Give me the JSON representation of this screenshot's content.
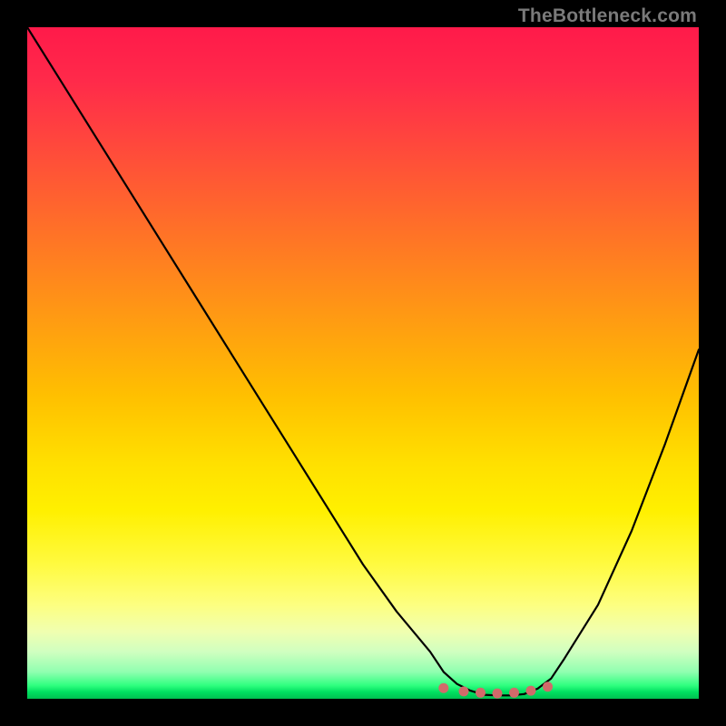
{
  "watermark": "TheBottleneck.com",
  "chart_data": {
    "type": "line",
    "title": "",
    "xlabel": "",
    "ylabel": "",
    "xlim": [
      0,
      100
    ],
    "ylim": [
      0,
      100
    ],
    "grid": false,
    "series": [
      {
        "name": "bottleneck-curve",
        "x": [
          0,
          5,
          10,
          15,
          20,
          25,
          30,
          35,
          40,
          45,
          50,
          55,
          60,
          62,
          64,
          66,
          68,
          70,
          72,
          74,
          76,
          78,
          80,
          85,
          90,
          95,
          100
        ],
        "y": [
          100,
          92,
          84,
          76,
          68,
          60,
          52,
          44,
          36,
          28,
          20,
          13,
          7,
          4,
          2.2,
          1.2,
          0.6,
          0.5,
          0.5,
          0.7,
          1.5,
          3,
          6,
          14,
          25,
          38,
          52
        ]
      }
    ],
    "markers": {
      "name": "bottom-dots",
      "color": "#d16a6a",
      "points": [
        {
          "x": 62.0,
          "y": 1.6
        },
        {
          "x": 65.0,
          "y": 1.1
        },
        {
          "x": 67.5,
          "y": 0.9
        },
        {
          "x": 70.0,
          "y": 0.8
        },
        {
          "x": 72.5,
          "y": 0.9
        },
        {
          "x": 75.0,
          "y": 1.2
        },
        {
          "x": 77.5,
          "y": 1.8
        }
      ]
    },
    "gradient_stops": [
      {
        "pos": 0.0,
        "color": "#ff1a4a"
      },
      {
        "pos": 0.25,
        "color": "#ff6030"
      },
      {
        "pos": 0.55,
        "color": "#ffc000"
      },
      {
        "pos": 0.8,
        "color": "#fdff80"
      },
      {
        "pos": 0.96,
        "color": "#90ffb0"
      },
      {
        "pos": 1.0,
        "color": "#00c050"
      }
    ]
  }
}
